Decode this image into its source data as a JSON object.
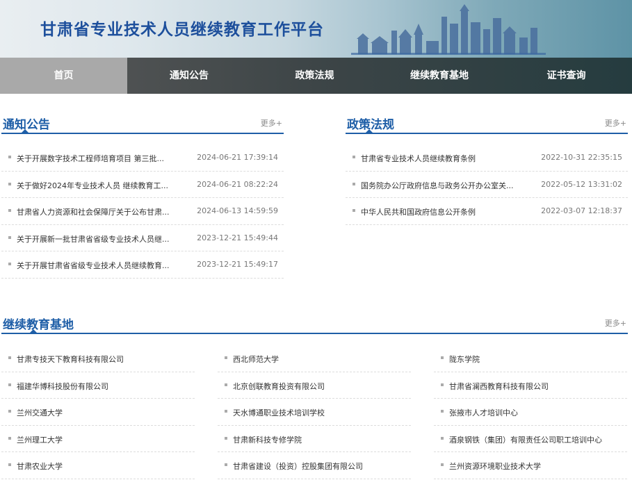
{
  "header": {
    "title": "甘肃省专业技术人员继续教育工作平台"
  },
  "nav": {
    "items": [
      "首页",
      "通知公告",
      "政策法规",
      "继续教育基地",
      "证书查询"
    ]
  },
  "notices": {
    "title": "通知公告",
    "more": "更多+",
    "items": [
      {
        "text": "关于开展数字技术工程师培育项目 第三批...",
        "date": "2024-06-21 17:39:14"
      },
      {
        "text": "关于做好2024年专业技术人员 继续教育工...",
        "date": "2024-06-21 08:22:24"
      },
      {
        "text": "甘肃省人力资源和社会保障厅关于公布甘肃...",
        "date": "2024-06-13 14:59:59"
      },
      {
        "text": "关于开展新一批甘肃省省级专业技术人员继...",
        "date": "2023-12-21 15:49:44"
      },
      {
        "text": "关于开展甘肃省省级专业技术人员继续教育...",
        "date": "2023-12-21 15:49:17"
      }
    ]
  },
  "policies": {
    "title": "政策法规",
    "more": "更多+",
    "items": [
      {
        "text": "甘肃省专业技术人员继续教育条例",
        "date": "2022-10-31 22:35:15"
      },
      {
        "text": "国务院办公厅政府信息与政务公开办公室关...",
        "date": "2022-05-12 13:31:02"
      },
      {
        "text": "中华人民共和国政府信息公开条例",
        "date": "2022-03-07 12:18:37"
      }
    ]
  },
  "bases": {
    "title": "继续教育基地",
    "more": "更多+",
    "columns": [
      [
        "甘肃专技天下教育科技有限公司",
        "福建华博科技股份有限公司",
        "兰州交通大学",
        "兰州理工大学",
        "甘肃农业大学"
      ],
      [
        "西北师范大学",
        "北京创联教育投资有限公司",
        "天水博通职业技术培训学校",
        "甘肃新科技专修学院",
        "甘肃省建设（投资）控股集团有限公司"
      ],
      [
        "陇东学院",
        "甘肃省澜西教育科技有限公司",
        "张掖市人才培训中心",
        "酒泉钢铁（集团）有限责任公司职工培训中心",
        "兰州资源环境职业技术大学"
      ]
    ]
  }
}
